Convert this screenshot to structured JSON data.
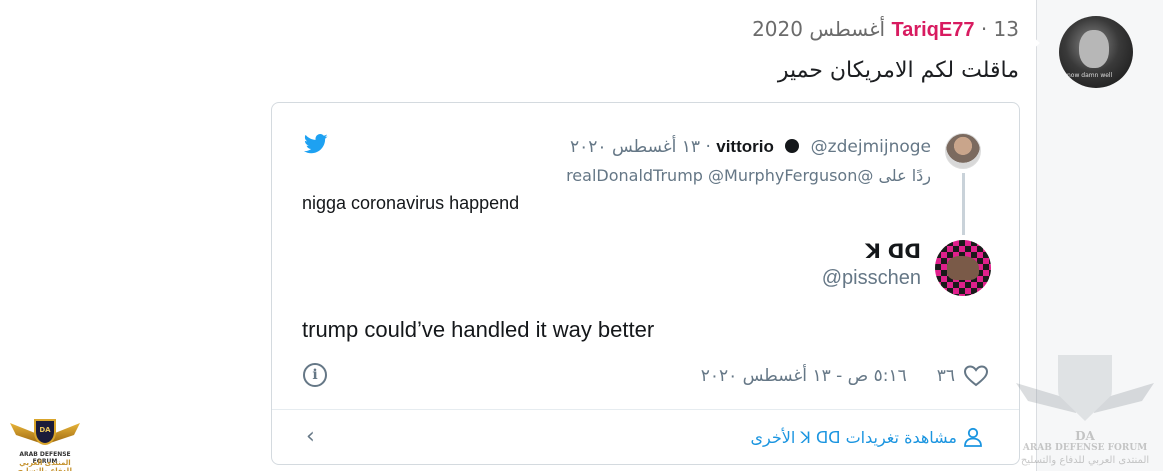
{
  "post": {
    "username": "TariqE77",
    "separator": "·",
    "date": "13 أغسطس 2020",
    "text": "ماقلت لكم الامريكان حمير",
    "avatar_caption": "now damn well"
  },
  "embed": {
    "parent": {
      "name": "vittorio",
      "handle": "@zdejmijnoge",
      "separator": "·",
      "date": "١٣ أغسطس ٢٠٢٠",
      "reply_prefix": "ردًا على",
      "reply_to": "@realDonaldTrump @MurphyFerguson",
      "text": "nigga coronavirus happend"
    },
    "tweet": {
      "name": "ꓘ ᗡᗡ",
      "handle": "@pisschen",
      "text": "trump could’ve handled it way better",
      "likes": "٣٦",
      "timestamp": "٥:١٦ ص - ١٣ أغسطس ٢٠٢٠",
      "info_glyph": "i"
    },
    "footer": {
      "see_more": "مشاهدة تغريدات ꓘ ᗡᗡ الأخرى",
      "chevron": "‹"
    }
  },
  "icons": {
    "twitter": "twitter-bird-icon",
    "heart": "heart-icon",
    "info": "info-icon",
    "user": "user-icon",
    "chevron": "chevron-left-icon"
  },
  "colors": {
    "username": "#d81b60",
    "twitter_blue": "#1da1f2",
    "link_blue": "#1b95e0",
    "muted": "#657786"
  },
  "watermarks": {
    "left_title": "ARAB DEFENSE FORUM",
    "left_arabic": "المنتدى العربي للدفاع والتسليح",
    "left_badge": "DA",
    "right_badge": "DA",
    "right_title": "ARAB DEFENSE FORUM",
    "right_arabic": "المنتدى العربي للدفاع والتسليح"
  }
}
